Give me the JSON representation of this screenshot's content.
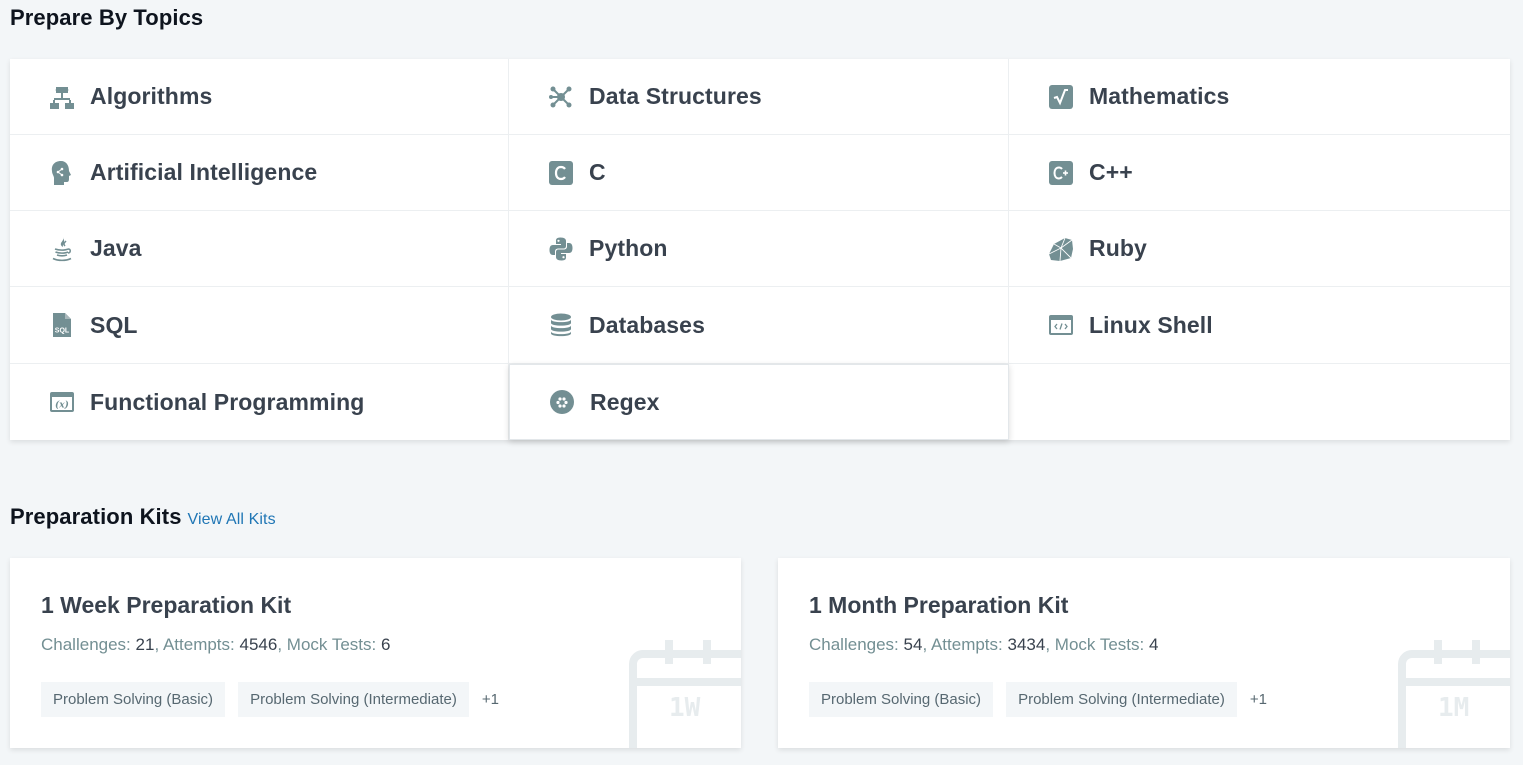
{
  "topics_section": {
    "title": "Prepare By Topics",
    "topics": [
      {
        "label": "Algorithms",
        "icon": "algorithms-icon"
      },
      {
        "label": "Data Structures",
        "icon": "data-structures-icon"
      },
      {
        "label": "Mathematics",
        "icon": "mathematics-icon"
      },
      {
        "label": "Artificial Intelligence",
        "icon": "artificial-intelligence-icon"
      },
      {
        "label": "C",
        "icon": "c-icon"
      },
      {
        "label": "C++",
        "icon": "cpp-icon"
      },
      {
        "label": "Java",
        "icon": "java-icon"
      },
      {
        "label": "Python",
        "icon": "python-icon"
      },
      {
        "label": "Ruby",
        "icon": "ruby-icon"
      },
      {
        "label": "SQL",
        "icon": "sql-icon"
      },
      {
        "label": "Databases",
        "icon": "databases-icon"
      },
      {
        "label": "Linux Shell",
        "icon": "linux-shell-icon"
      },
      {
        "label": "Functional Programming",
        "icon": "functional-programming-icon"
      },
      {
        "label": "Regex",
        "icon": "regex-icon"
      }
    ]
  },
  "kits_section": {
    "title": "Preparation Kits",
    "view_all_label": "View All Kits",
    "kits": [
      {
        "title": "1 Week Preparation Kit",
        "challenges_label": "Challenges:",
        "challenges": "21",
        "attempts_label": "Attempts:",
        "attempts": "4546",
        "mock_tests_label": "Mock Tests:",
        "mock_tests": "6",
        "tags": [
          "Problem Solving (Basic)",
          "Problem Solving (Intermediate)"
        ],
        "more": "+1",
        "calendar_text": "1W"
      },
      {
        "title": "1 Month Preparation Kit",
        "challenges_label": "Challenges:",
        "challenges": "54",
        "attempts_label": "Attempts:",
        "attempts": "3434",
        "mock_tests_label": "Mock Tests:",
        "mock_tests": "4",
        "tags": [
          "Problem Solving (Basic)",
          "Problem Solving (Intermediate)"
        ],
        "more": "+1",
        "calendar_text": "1M"
      }
    ]
  },
  "colors": {
    "background": "#f3f6f8",
    "heading": "#0e141e",
    "text": "#39424e",
    "muted": "#738f93",
    "icon": "#738f93",
    "link": "#1f76b5",
    "tag_bg": "#f3f6f8"
  }
}
